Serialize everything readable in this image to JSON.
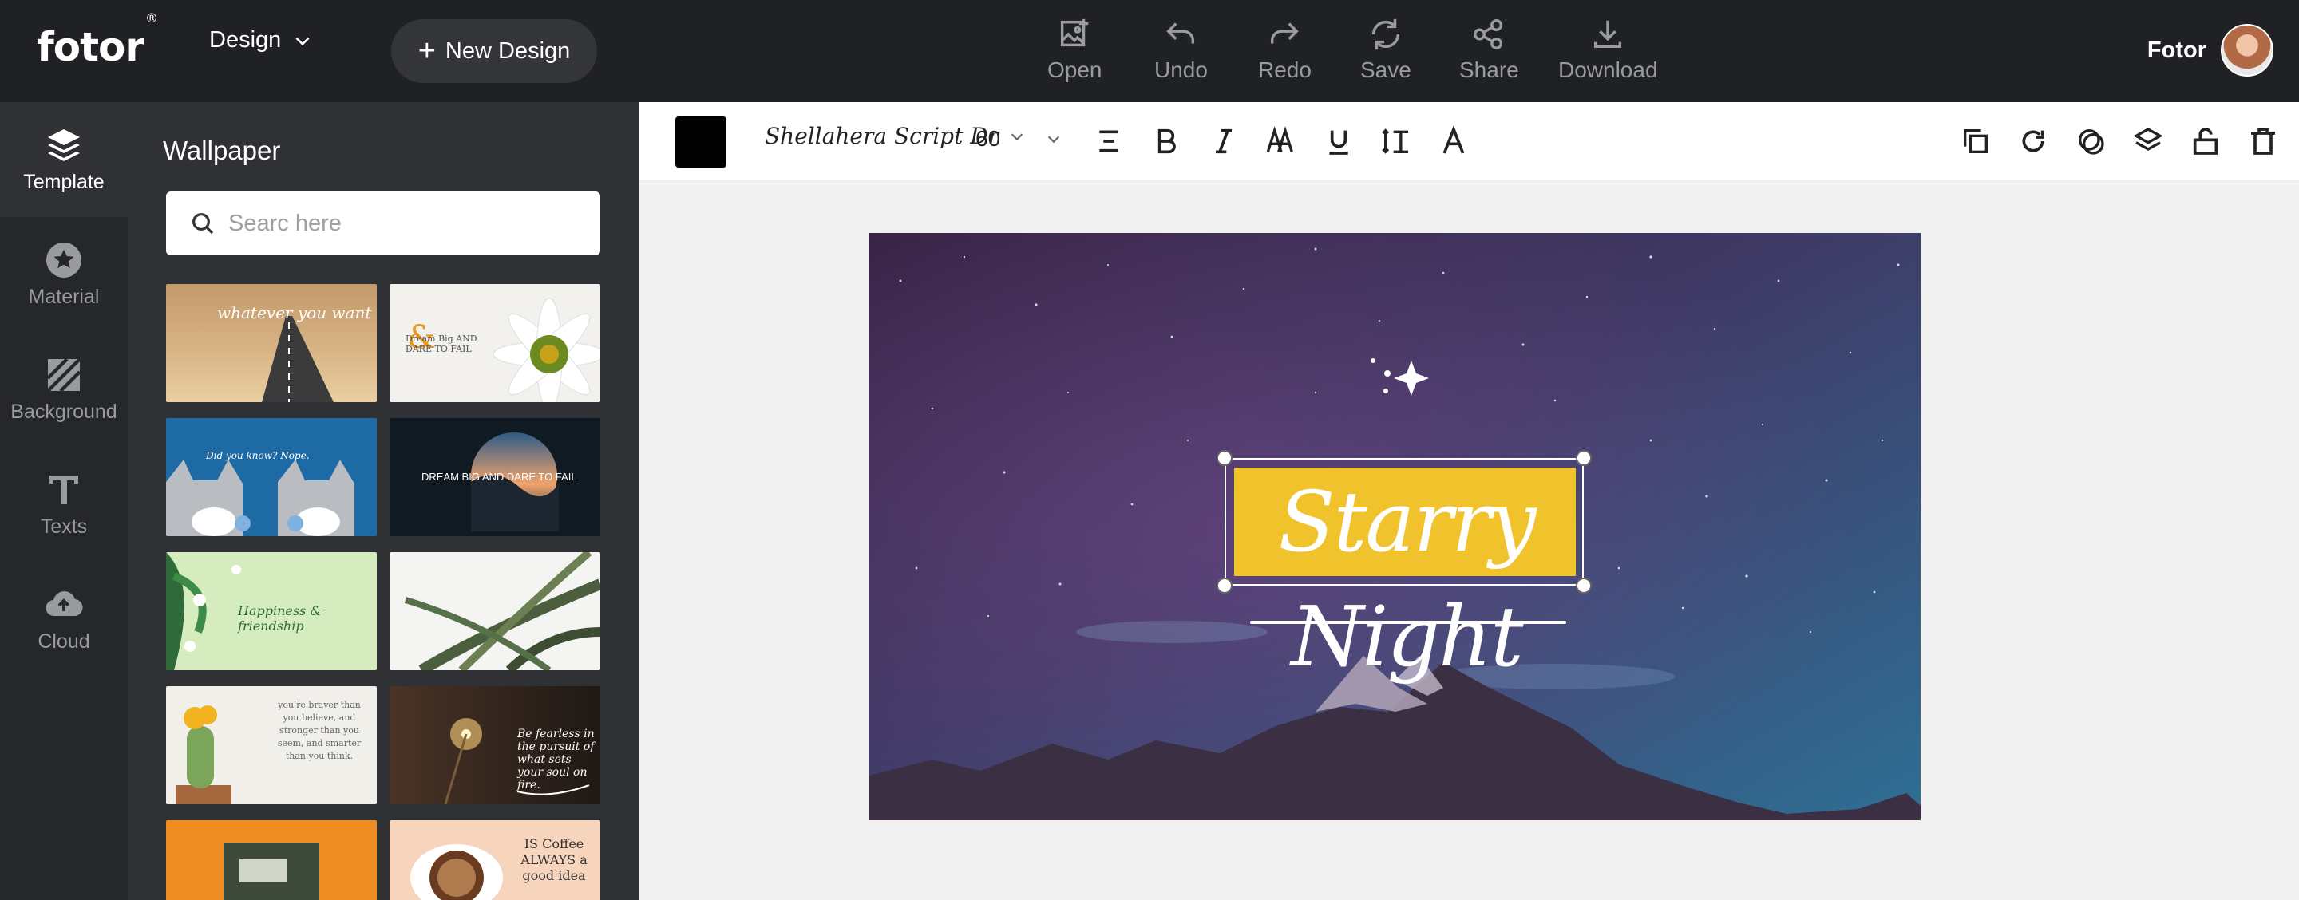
{
  "app": {
    "logo": "fotor",
    "logo_mark": "®"
  },
  "header": {
    "design_menu": "Design",
    "new_design": "New Design",
    "tools": [
      {
        "label": "Open",
        "icon": "open-image-icon"
      },
      {
        "label": "Undo",
        "icon": "undo-icon"
      },
      {
        "label": "Redo",
        "icon": "redo-icon"
      },
      {
        "label": "Save",
        "icon": "save-icon"
      },
      {
        "label": "Share",
        "icon": "share-icon"
      },
      {
        "label": "Download",
        "icon": "download-icon"
      }
    ],
    "user_name": "Fotor"
  },
  "leftnav": {
    "items": [
      {
        "label": "Template",
        "icon": "layers-icon",
        "active": true
      },
      {
        "label": "Material",
        "icon": "star-icon",
        "active": false
      },
      {
        "label": "Background",
        "icon": "stripes-icon",
        "active": false
      },
      {
        "label": "Texts",
        "icon": "text-t-icon",
        "active": false
      },
      {
        "label": "Cloud",
        "icon": "cloud-upload-icon",
        "active": false
      }
    ]
  },
  "panel": {
    "title": "Wallpaper",
    "search_placeholder": "Searc here",
    "thumbs": [
      {
        "caption": "whatever you want"
      },
      {
        "caption": "Dream Big AND DARE TO FAIL"
      },
      {
        "caption": "Did you know? Nope."
      },
      {
        "caption": "DREAM BIG AND DARE TO FAIL"
      },
      {
        "caption": "Happiness & friendship"
      },
      {
        "caption": ""
      },
      {
        "caption": "you're braver than you believe, and stronger than you seem, and smarter than you think."
      },
      {
        "caption": "Be fearless in the pursuit of what sets your soul on fire."
      },
      {
        "caption": ""
      },
      {
        "caption": "IS Coffee ALWAYS a good idea"
      }
    ]
  },
  "textbar": {
    "color": "#000000",
    "font": "Shellahera Script Dr",
    "size": "60",
    "buttons": [
      {
        "name": "align-icon"
      },
      {
        "name": "bold-icon"
      },
      {
        "name": "italic-icon"
      },
      {
        "name": "letter-case-icon"
      },
      {
        "name": "underline-icon"
      },
      {
        "name": "line-spacing-icon"
      },
      {
        "name": "text-effect-icon"
      }
    ],
    "right_buttons": [
      {
        "name": "duplicate-icon"
      },
      {
        "name": "rotate-icon"
      },
      {
        "name": "opacity-icon"
      },
      {
        "name": "layer-icon"
      },
      {
        "name": "lock-icon"
      },
      {
        "name": "delete-icon"
      }
    ]
  },
  "canvas": {
    "headline": "Starry Night",
    "banner_color": "#f0c22c"
  }
}
